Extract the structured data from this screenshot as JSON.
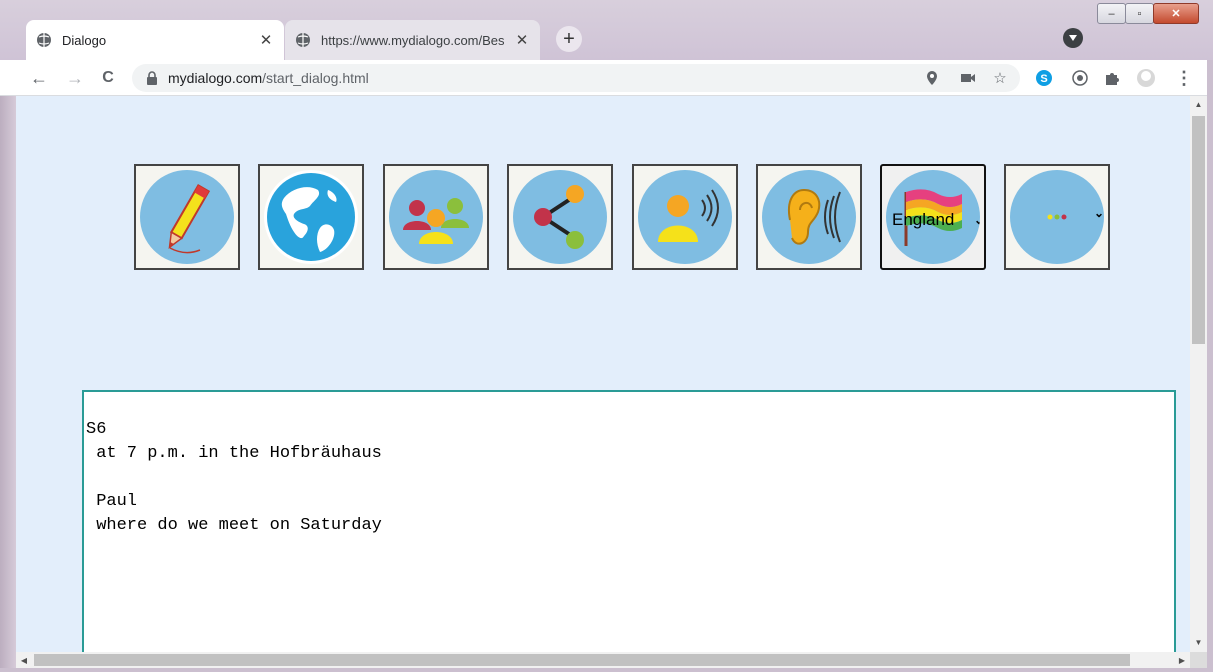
{
  "browser": {
    "tabs": [
      {
        "title": "Dialogo",
        "close": "✕",
        "active": true
      },
      {
        "title": "https://www.mydialogo.com/Bes",
        "close": "✕",
        "active": false
      }
    ],
    "new_tab_label": "+",
    "nav": {
      "back": "←",
      "forward": "→",
      "reload": "C"
    },
    "address": {
      "host": "mydialogo.com",
      "path": "/start_dialog.html"
    },
    "window_controls": {
      "minimize": "–",
      "maximize": "▫",
      "close": "✕"
    },
    "toolbar_icons": [
      "location-icon",
      "camera-icon",
      "star-icon",
      "skype-icon",
      "extension-o-icon",
      "puzzle-icon",
      "profile-icon",
      "menu-icon"
    ],
    "menu_glyph": "⋮"
  },
  "page": {
    "icons": [
      {
        "name": "pencil-icon"
      },
      {
        "name": "globe-icon"
      },
      {
        "name": "group-icon"
      },
      {
        "name": "share-icon"
      },
      {
        "name": "speaker-icon"
      },
      {
        "name": "ear-icon"
      },
      {
        "name": "language-select"
      },
      {
        "name": "more-select"
      }
    ],
    "language": {
      "selected": "England"
    },
    "more": {
      "selected": "..."
    },
    "dialog_lines": [
      "S6",
      " at 7 p.m. in the Hofbräuhaus",
      "",
      " Paul",
      " where do we meet on Saturday"
    ]
  },
  "colors": {
    "page_bg": "#e3eefb",
    "circle": "#7fbde2",
    "textarea_border": "#2a9b96"
  }
}
